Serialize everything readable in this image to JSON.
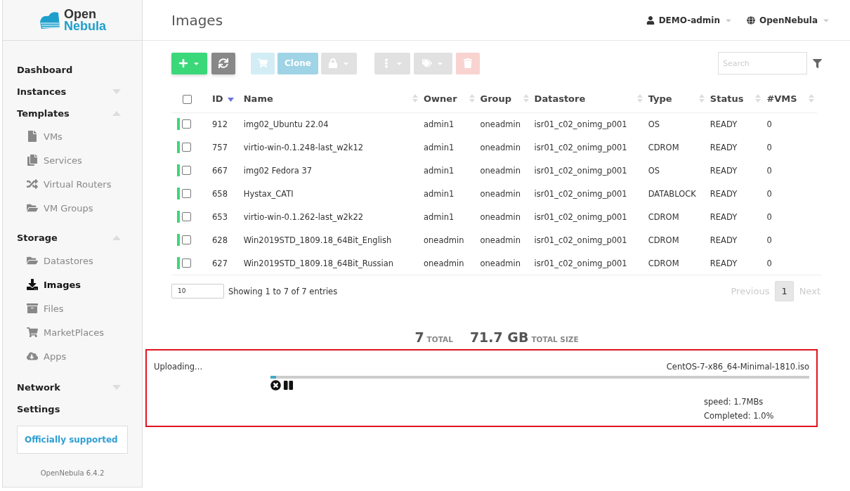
{
  "logo": {
    "line1": "Open",
    "line2": "Nebula"
  },
  "sidebar": {
    "items": [
      {
        "label": "Dashboard",
        "kind": "link"
      },
      {
        "label": "Instances",
        "kind": "group",
        "expanded": false
      },
      {
        "label": "Templates",
        "kind": "group",
        "expanded": true,
        "children": [
          {
            "label": "VMs",
            "selected": false
          },
          {
            "label": "Services",
            "selected": false
          },
          {
            "label": "Virtual Routers",
            "selected": false
          },
          {
            "label": "VM Groups",
            "selected": false
          }
        ]
      },
      {
        "label": "Storage",
        "kind": "group",
        "expanded": true,
        "children": [
          {
            "label": "Datastores",
            "selected": false
          },
          {
            "label": "Images",
            "selected": true
          },
          {
            "label": "Files",
            "selected": false
          },
          {
            "label": "MarketPlaces",
            "selected": false
          },
          {
            "label": "Apps",
            "selected": false
          }
        ]
      },
      {
        "label": "Network",
        "kind": "group",
        "expanded": false
      },
      {
        "label": "Settings",
        "kind": "link"
      }
    ],
    "support": "Officially supported",
    "version": "OpenNebula 6.4.2"
  },
  "header": {
    "title": "Images",
    "user": "DEMO-admin",
    "zone": "OpenNebula"
  },
  "toolbar": [
    {
      "kind": "add",
      "disabled": false
    },
    {
      "kind": "refresh",
      "disabled": false
    },
    {
      "kind": "cart",
      "disabled": true
    },
    {
      "kind": "clone",
      "label": "Clone",
      "disabled": true
    },
    {
      "kind": "lock",
      "disabled": true
    },
    {
      "kind": "more",
      "disabled": true
    },
    {
      "kind": "tags",
      "disabled": true
    },
    {
      "kind": "delete",
      "disabled": true
    }
  ],
  "search": {
    "placeholder": "Search"
  },
  "table": {
    "columns": [
      {
        "label": "ID",
        "sorted": true
      },
      {
        "label": "Name",
        "sorted": false
      },
      {
        "label": "Owner",
        "sorted": false
      },
      {
        "label": "Group",
        "sorted": false
      },
      {
        "label": "Datastore",
        "sorted": false
      },
      {
        "label": "Type",
        "sorted": false
      },
      {
        "label": "Status",
        "sorted": false
      },
      {
        "label": "#VMS",
        "sorted": false
      }
    ],
    "all_checked": false,
    "rows": [
      {
        "checked": false,
        "color": "#3ed67b",
        "cells": [
          "912",
          "img02_Ubuntu 22.04",
          "admin1",
          "oneadmin",
          "isr01_c02_onimg_p001",
          "OS",
          "READY",
          "0"
        ]
      },
      {
        "checked": false,
        "color": "#3ed67b",
        "cells": [
          "757",
          "virtio-win-0.1.248-last_w2k12",
          "admin1",
          "oneadmin",
          "isr01_c02_onimg_p001",
          "CDROM",
          "READY",
          "0"
        ]
      },
      {
        "checked": false,
        "color": "#3ed67b",
        "cells": [
          "667",
          "img02 Fedora 37",
          "admin1",
          "oneadmin",
          "isr01_c02_onimg_p001",
          "OS",
          "READY",
          "0"
        ]
      },
      {
        "checked": false,
        "color": "#3ed67b",
        "cells": [
          "658",
          "Hystax_CATI",
          "admin1",
          "oneadmin",
          "isr01_c02_onimg_p001",
          "DATABLOCK",
          "READY",
          "0"
        ]
      },
      {
        "checked": false,
        "color": "#3ed67b",
        "cells": [
          "653",
          "virtio-win-0.1.262-last_w2k22",
          "admin1",
          "oneadmin",
          "isr01_c02_onimg_p001",
          "CDROM",
          "READY",
          "0"
        ]
      },
      {
        "checked": false,
        "color": "#3ed67b",
        "cells": [
          "628",
          "Win2019STD_1809.18_64Bit_English",
          "oneadmin",
          "oneadmin",
          "isr01_c02_onimg_p001",
          "CDROM",
          "READY",
          "0"
        ]
      },
      {
        "checked": false,
        "color": "#3ed67b",
        "cells": [
          "627",
          "Win2019STD_1809.18_64Bit_Russian",
          "oneadmin",
          "oneadmin",
          "isr01_c02_onimg_p001",
          "CDROM",
          "READY",
          "0"
        ]
      }
    ]
  },
  "footer": {
    "page_size": "10",
    "info": "Showing 1 to 7 of 7 entries",
    "pages": [
      {
        "label": "Previous",
        "kind": "prev",
        "disabled": true
      },
      {
        "label": "1",
        "kind": "page",
        "selected": true
      },
      {
        "label": "Next",
        "kind": "next",
        "disabled": true
      }
    ]
  },
  "totals": [
    {
      "value": "7",
      "label": "TOTAL"
    },
    {
      "value": "71.7 GB",
      "label": "TOTAL SIZE"
    }
  ],
  "upload": {
    "status": "Uploading...",
    "file": "CentOS-7-x86_64-Minimal-1810.iso",
    "level": 0.01,
    "speed": "speed: 1.7MBs",
    "completed": "Completed: 1.0%"
  }
}
